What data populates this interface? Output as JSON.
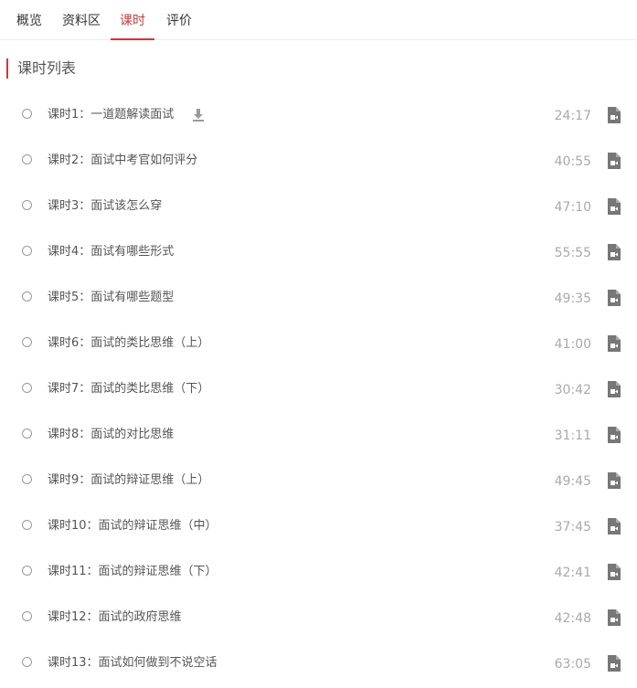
{
  "tabs": [
    {
      "label": "概览",
      "active": false
    },
    {
      "label": "资料区",
      "active": false
    },
    {
      "label": "课时",
      "active": true
    },
    {
      "label": "评价",
      "active": false
    }
  ],
  "accent_color": "#c73b3b",
  "section": {
    "title": "课时列表"
  },
  "lessons": [
    {
      "title": "课时1：一道题解读面试",
      "duration": "24:17",
      "icon": "video-file-icon",
      "download_icon": "download-icon"
    },
    {
      "title": "课时2：面试中考官如何评分",
      "duration": "40:55",
      "icon": "video-file-icon"
    },
    {
      "title": "课时3：面试该怎么穿",
      "duration": "47:10",
      "icon": "video-file-icon"
    },
    {
      "title": "课时4：面试有哪些形式",
      "duration": "55:55",
      "icon": "video-file-icon"
    },
    {
      "title": "课时5：面试有哪些题型",
      "duration": "49:35",
      "icon": "video-file-icon"
    },
    {
      "title": "课时6：面试的类比思维（上）",
      "duration": "41:00",
      "icon": "video-file-icon"
    },
    {
      "title": "课时7：面试的类比思维（下）",
      "duration": "30:42",
      "icon": "video-file-icon"
    },
    {
      "title": "课时8：面试的对比思维",
      "duration": "31:11",
      "icon": "video-file-icon"
    },
    {
      "title": "课时9：面试的辩证思维（上）",
      "duration": "49:45",
      "icon": "video-file-icon"
    },
    {
      "title": "课时10：面试的辩证思维（中）",
      "duration": "37:45",
      "icon": "video-file-icon"
    },
    {
      "title": "课时11：面试的辩证思维（下）",
      "duration": "42:41",
      "icon": "video-file-icon"
    },
    {
      "title": "课时12：面试的政府思维",
      "duration": "42:48",
      "icon": "video-file-icon"
    },
    {
      "title": "课时13：面试如何做到不说空话",
      "duration": "63:05",
      "icon": "video-file-icon"
    }
  ]
}
